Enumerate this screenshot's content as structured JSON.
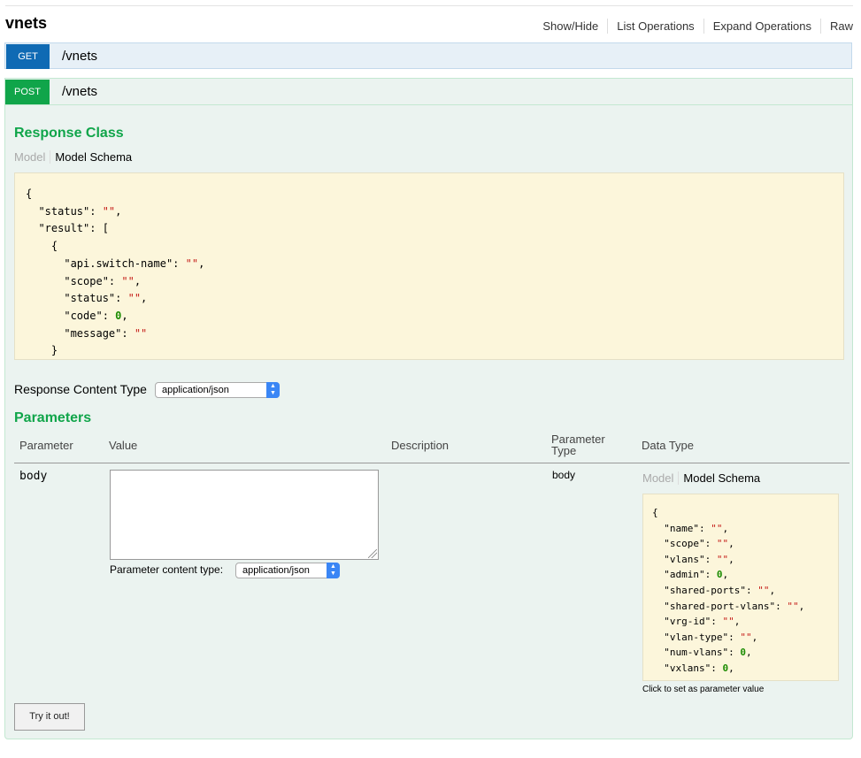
{
  "resource": {
    "title": "vnets",
    "operations": [
      "Show/Hide",
      "List Operations",
      "Expand Operations",
      "Raw"
    ]
  },
  "get_op": {
    "method": "GET",
    "path": "/vnets",
    "color": "#0f6ab4"
  },
  "post_op": {
    "method": "POST",
    "path": "/vnets",
    "color": "#10a54a",
    "response_class": {
      "title": "Response Class",
      "tab_model": "Model",
      "tab_schema": "Model Schema"
    },
    "response_content_type": {
      "label": "Response Content Type",
      "selected": "application/json"
    },
    "parameters": {
      "title": "Parameters",
      "headers": {
        "parameter": "Parameter",
        "value": "Value",
        "description": "Description",
        "parameter_type_1": "Parameter",
        "parameter_type_2": "Type",
        "data_type": "Data Type"
      },
      "row": {
        "name": "body",
        "content_type_label": "Parameter content type:",
        "content_type_selected": "application/json",
        "param_type": "body",
        "tab_model": "Model",
        "tab_schema": "Model Schema",
        "hint": "Click to set as parameter value"
      }
    },
    "try_button": "Try it out!"
  }
}
